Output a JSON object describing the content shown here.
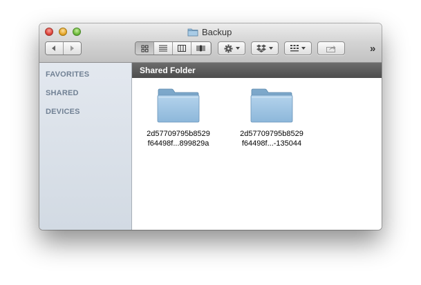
{
  "window": {
    "title": "Backup"
  },
  "toolbar": {
    "overflow": "»"
  },
  "sidebar": {
    "favorites": "FAVORITES",
    "shared": "SHARED",
    "devices": "DEVICES"
  },
  "pathbar": {
    "label": "Shared Folder"
  },
  "items": [
    {
      "line1": "2d57709795b8529",
      "line2": "f64498f...899829a"
    },
    {
      "line1": "2d57709795b8529",
      "line2": "f64498f...-135044"
    }
  ],
  "colors": {
    "folder": "#8fb8d8",
    "pathbar": "#555555",
    "sidebar": "#dbe1e9"
  }
}
